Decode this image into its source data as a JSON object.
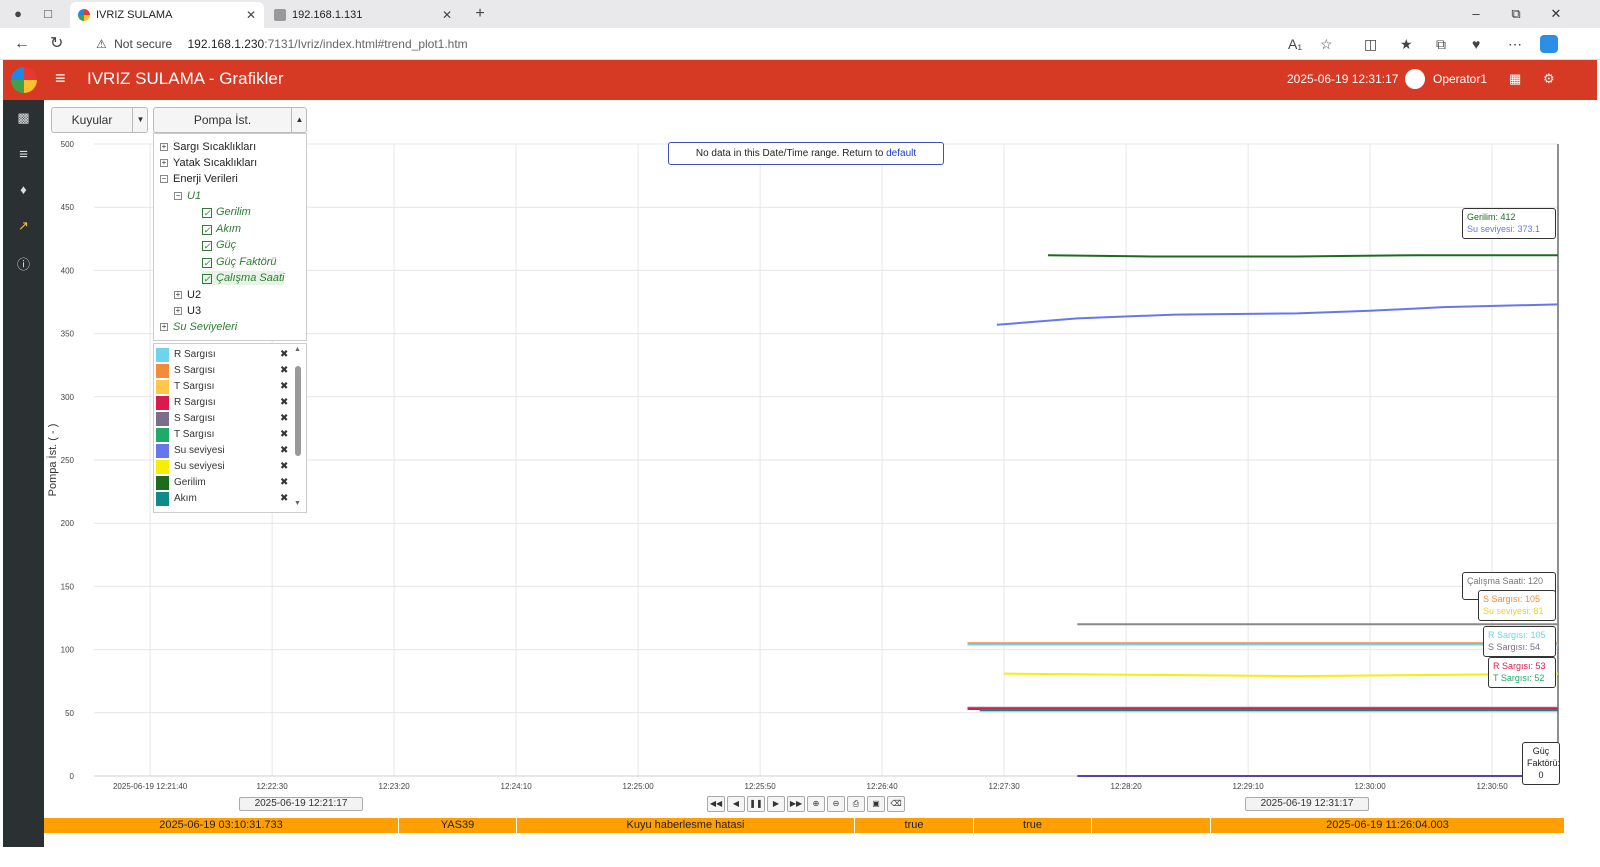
{
  "browser": {
    "tabs": [
      {
        "title": "IVRIZ SULAMA"
      },
      {
        "title": "192.168.1.131"
      }
    ],
    "security": "Not secure",
    "url_host": "192.168.1.230",
    "url_rest": ":7131/Ivriz/index.html#trend_plot1.htm"
  },
  "app": {
    "title": "IVRIZ SULAMA - Grafikler",
    "datetime": "2025-06-19 12:31:17",
    "user": "Operator1"
  },
  "selectors": {
    "group": "Kuyular",
    "item": "Pompa İst."
  },
  "tree": {
    "nodes": [
      "Sargı Sıcaklıkları",
      "Yatak Sıcaklıkları",
      "Enerji Verileri",
      "U1",
      "Gerilim",
      "Akım",
      "Güç",
      "Güç Faktörü",
      "Çalışma Saati",
      "U2",
      "U3",
      "Su Seviyeleri"
    ]
  },
  "legend": [
    {
      "name": "R Sargısı",
      "color": "#6fd3ee"
    },
    {
      "name": "S Sargısı",
      "color": "#f28c38"
    },
    {
      "name": "T Sargısı",
      "color": "#ffc84a"
    },
    {
      "name": "R Sargısı",
      "color": "#d81b4a"
    },
    {
      "name": "S Sargısı",
      "color": "#7b6e8a"
    },
    {
      "name": "T Sargısı",
      "color": "#1faa6a"
    },
    {
      "name": "Su seviyesi",
      "color": "#6677ee"
    },
    {
      "name": "Su seviyesi",
      "color": "#f5f000"
    },
    {
      "name": "Gerilim",
      "color": "#1d6b1d"
    },
    {
      "name": "Akım",
      "color": "#0e8a8a"
    }
  ],
  "nodata": {
    "text": "No data in this Date/Time range. Return to",
    "link": "default"
  },
  "tooltips": {
    "gerilim": "Gerilim: 412",
    "su_seviyesi_1": "Su seviyesi: 373.1",
    "calisma_saati": "Çalışma Saati: 120",
    "s_sargisi_1": "S Sargısı: 105",
    "su_seviyesi_2": "Su seviyesi: 81",
    "r_sargisi_1": "R Sargısı: 105",
    "s_sargisi_2": "S Sargısı: 54",
    "r_sargisi_2": "R Sargısı: 53",
    "t_sargisi_2": "T Sargısı: 52",
    "guc_faktoru_label": "Güç",
    "guc_faktoru_label2": "Faktörü:",
    "guc_faktoru_value": "0"
  },
  "range": {
    "start": "2025-06-19 12:21:17",
    "end": "2025-06-19 12:31:17"
  },
  "alarm": {
    "cells": [
      "2025-06-19 03:10:31.733",
      "YAS39",
      "Kuyu haberlesme hatasi",
      "true",
      "true",
      "",
      "2025-06-19 11:26:04.003"
    ]
  },
  "colors": {
    "appbar": "#d63a24",
    "sidebar": "#2b3033",
    "alarm": "#ffa000"
  },
  "chart_data": {
    "type": "line",
    "title": "",
    "xlabel": "",
    "ylabel": "Pompa İst. ( - )",
    "ylim": [
      0,
      500
    ],
    "yticks": [
      0,
      50,
      100,
      150,
      200,
      250,
      300,
      350,
      400,
      450,
      500
    ],
    "x_range": [
      "12:21:17",
      "12:31:17"
    ],
    "xtick_labels": [
      "2025-06-19 12:21:40",
      "12:22:30",
      "12:23:20",
      "12:24:10",
      "12:25:00",
      "12:25:50",
      "12:26:40",
      "12:27:30",
      "12:28:20",
      "12:29:10",
      "12:30:00",
      "12:30:50"
    ],
    "xticks": [
      "12:21:40",
      "12:22:30",
      "12:23:20",
      "12:24:10",
      "12:25:00",
      "12:25:50",
      "12:26:40",
      "12:27:30",
      "12:28:20",
      "12:29:10",
      "12:30:00",
      "12:30:50"
    ],
    "grid": true,
    "series": [
      {
        "name": "Gerilim",
        "color": "#1d6b1d",
        "x": [
          "12:27:48",
          "12:28:30",
          "12:29:30",
          "12:30:20",
          "12:31:17"
        ],
        "y": [
          412,
          411,
          411,
          412,
          412
        ]
      },
      {
        "name": "Su seviyesi",
        "color": "#6677ee",
        "x": [
          "12:27:27",
          "12:28:00",
          "12:28:40",
          "12:29:30",
          "12:30:00",
          "12:30:30",
          "12:31:17"
        ],
        "y": [
          357,
          362,
          365,
          366,
          368,
          371,
          373.1
        ]
      },
      {
        "name": "Çalışma Saati",
        "color": "#888888",
        "x": [
          "12:28:00",
          "12:31:17"
        ],
        "y": [
          120,
          120
        ]
      },
      {
        "name": "S Sargısı",
        "color": "#f28c38",
        "x": [
          "12:27:15",
          "12:31:17"
        ],
        "y": [
          105,
          105
        ]
      },
      {
        "name": "R Sargısı",
        "color": "#6fd3ee",
        "x": [
          "12:27:15",
          "12:31:17"
        ],
        "y": [
          104,
          104
        ]
      },
      {
        "name": "Su seviyesi",
        "color": "#f5f000",
        "x": [
          "12:27:30",
          "12:28:30",
          "12:29:30",
          "12:30:30",
          "12:31:17"
        ],
        "y": [
          81,
          80,
          79,
          80,
          81
        ]
      },
      {
        "name": "S Sargısı",
        "color": "#7b6e8a",
        "x": [
          "12:27:15",
          "12:31:17"
        ],
        "y": [
          54,
          54
        ]
      },
      {
        "name": "R Sargısı",
        "color": "#d81b4a",
        "x": [
          "12:27:15",
          "12:31:17"
        ],
        "y": [
          53,
          53
        ]
      },
      {
        "name": "T Sargısı",
        "color": "#1faa6a",
        "x": [
          "12:27:20",
          "12:31:17"
        ],
        "y": [
          52,
          52
        ]
      },
      {
        "name": "Akım",
        "color": "#0e8a8a",
        "x": [
          "12:27:20",
          "12:31:17"
        ],
        "y": [
          52,
          52
        ]
      },
      {
        "name": "Güç Faktörü",
        "color": "#5b3fae",
        "x": [
          "12:28:00",
          "12:31:17"
        ],
        "y": [
          0,
          0
        ]
      }
    ]
  }
}
